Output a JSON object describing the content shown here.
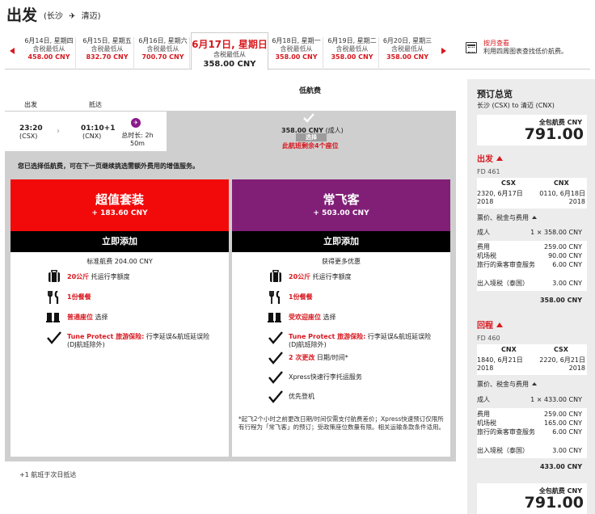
{
  "header": {
    "title": "出发",
    "origin": "(长沙",
    "arrow": "✈",
    "destination": "清迈)"
  },
  "datebar": {
    "dates": [
      {
        "date": "6月14日, 星期四",
        "label": "含税最低从",
        "price": "458.00 CNY"
      },
      {
        "date": "6月15日, 星期五",
        "label": "含税最低从",
        "price": "832.70 CNY"
      },
      {
        "date": "6月16日, 星期六",
        "label": "含税最低从",
        "price": "700.70 CNY"
      },
      {
        "date": "6月18日, 星期一",
        "label": "含税最低从",
        "price": "358.00 CNY"
      },
      {
        "date": "6月19日, 星期二",
        "label": "含税最低从",
        "price": "358.00 CNY"
      },
      {
        "date": "6月20日, 星期三",
        "label": "含税最低从",
        "price": "358.00 CNY"
      }
    ],
    "selected": {
      "date": "6月17日, 星期日",
      "label": "含税最低从",
      "price": "358.00 CNY"
    },
    "calendar_link": "按月查看",
    "calendar_desc": "利用四周图表查找低价航费。"
  },
  "flight": {
    "fare_title": "低航费",
    "label_depart": "出发",
    "label_arrive": "抵达",
    "dep_time": "23:20",
    "dep_code": "(CSX)",
    "arr_time": "01:10+1",
    "arr_code": "(CNX)",
    "duration_label": "总时长: 2h",
    "duration_min": "50m",
    "fare_price": "358.00 CNY",
    "fare_pax": "(成人)",
    "fare_select": "选择",
    "seats_left": "此航班剩余4个座位"
  },
  "upsell": {
    "message": "您已选择低航费，可在下一页继续挑选需额外费用的增值服务。",
    "packages": [
      {
        "name": "超值套装",
        "price": "+ 183.60 CNY",
        "add": "立即添加",
        "sub": "标准航费 204.00 CNY",
        "features": [
          {
            "hl": "20公斤",
            "text": " 托运行李额度"
          },
          {
            "hl": "1份餐餐",
            "text": ""
          },
          {
            "hl": "普通座位",
            "text": " 选择"
          },
          {
            "hl": "Tune Protect 旅游保险:",
            "text": " 行李延误&航班延误险 (DJ航班除外)"
          }
        ]
      },
      {
        "name": "常飞客",
        "price": "+ 503.00 CNY",
        "add": "立即添加",
        "sub": "获得更多优惠",
        "features": [
          {
            "hl": "20公斤",
            "text": " 托运行李额度"
          },
          {
            "hl": "1份餐餐",
            "text": ""
          },
          {
            "hl": "受欢迎座位",
            "text": " 选择"
          },
          {
            "hl": "Tune Protect 旅游保险:",
            "text": " 行李延误&航班延误险 (DJ航班除外)"
          },
          {
            "hl": "2 次更改",
            "text": " 日期/时间*"
          },
          {
            "hl": "",
            "text": "Xpress快速行李托运服务"
          },
          {
            "hl": "",
            "text": "优先登机"
          }
        ],
        "note": "*起飞2个小时之前更改日期/时间仅需支付航费差价；Xpress快速预订仅限所有行程为「常飞客」的预订；受政策座位数量有限。相关运输条款条件适用。"
      }
    ]
  },
  "next_day_note": "+1 航班于次日抵达",
  "summary": {
    "title": "预订总览",
    "route": "长沙 (CSX) to 清迈 (CNX)",
    "total_label": "全包航费 CNY",
    "total": "791.00",
    "fees_label": "票价、税金与费用",
    "outbound": {
      "section": "出发",
      "flight_no": "FD 461",
      "from": "CSX",
      "to": "CNX",
      "from_dt": "2320, 6月17日",
      "from_year": "2018",
      "to_dt": "0110, 6月18日",
      "to_year": "2018",
      "pax": "成人",
      "pax_fare": "1 × 358.00 CNY",
      "fees": [
        {
          "name": "费用",
          "value": "259.00 CNY"
        },
        {
          "name": "机场税",
          "value": "90.00 CNY"
        },
        {
          "name": "旅行的乘客审查服务",
          "value": "6.00 CNY"
        },
        {
          "name": "出入境税（泰国）",
          "value": "3.00 CNY"
        }
      ],
      "subtotal": "358.00 CNY"
    },
    "inbound": {
      "section": "回程",
      "flight_no": "FD 460",
      "from": "CNX",
      "to": "CSX",
      "from_dt": "1840, 6月21日",
      "from_year": "2018",
      "to_dt": "2220, 6月21日",
      "to_year": "2018",
      "pax": "成人",
      "pax_fare": "1 × 433.00 CNY",
      "fees": [
        {
          "name": "费用",
          "value": "259.00 CNY"
        },
        {
          "name": "机场税",
          "value": "165.00 CNY"
        },
        {
          "name": "旅行的乘客审查服务",
          "value": "6.00 CNY"
        },
        {
          "name": "出入境税（泰国）",
          "value": "3.00 CNY"
        }
      ],
      "subtotal": "433.00 CNY"
    }
  }
}
